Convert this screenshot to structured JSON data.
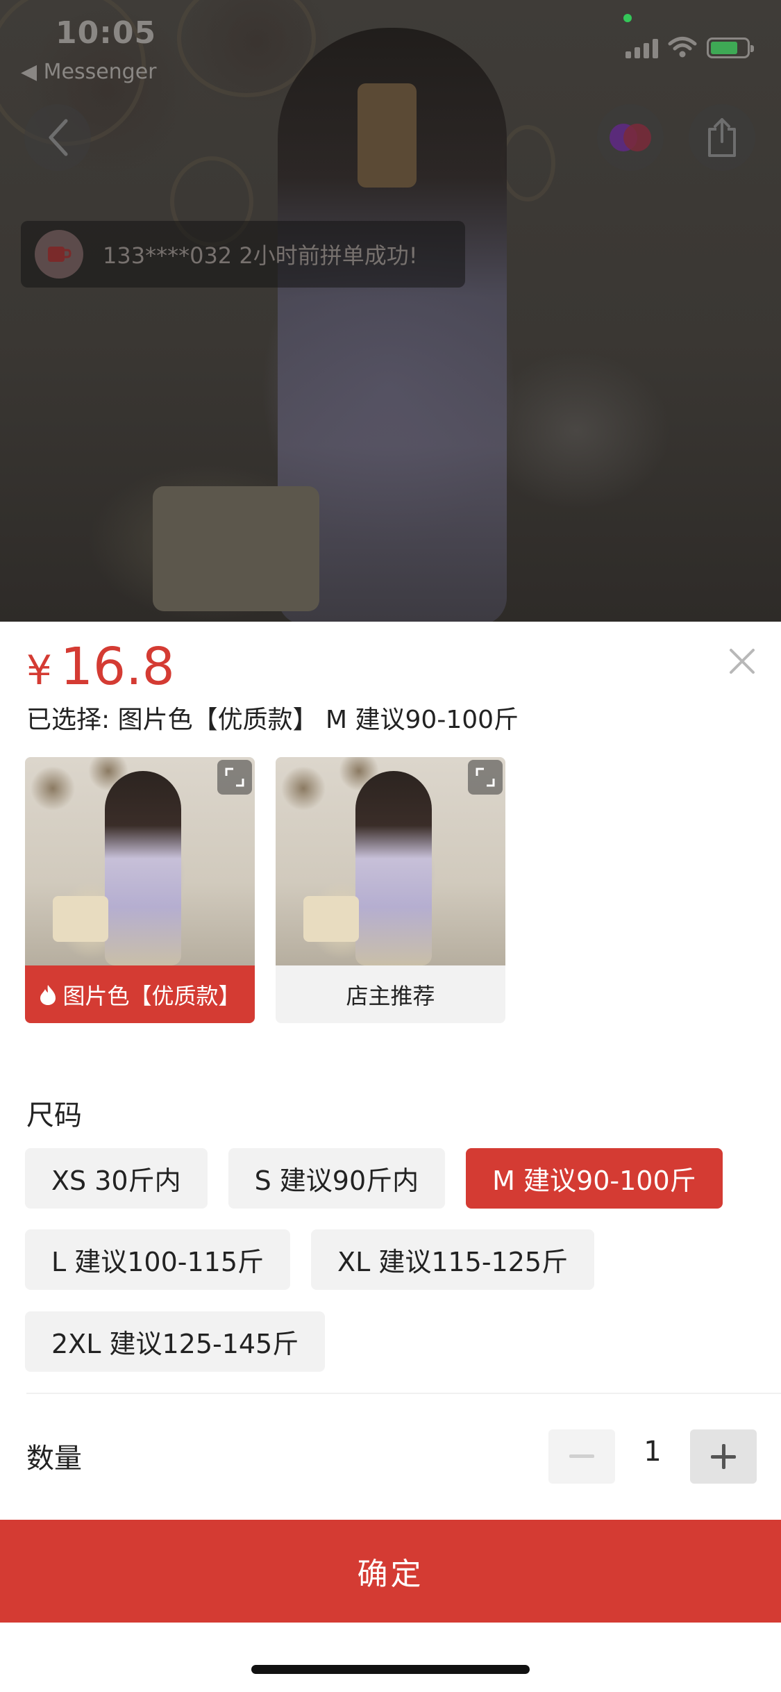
{
  "status_bar": {
    "time": "10:05",
    "back_app": "◀ Messenger",
    "icons": [
      "signal-icon",
      "wifi-icon",
      "battery-icon"
    ]
  },
  "photo_overlay": {
    "icons": [
      "back-icon",
      "favorite-icon",
      "share-icon"
    ],
    "notice": {
      "text": "133****032 2小时前拼单成功!",
      "icon": "cup-icon"
    }
  },
  "sheet": {
    "price_currency": "¥",
    "price_value": "16.8",
    "selected_text": "已选择: 图片色【优质款】 M 建议90-100斤",
    "colors": [
      {
        "label": "图片色【优质款】",
        "active": true,
        "icon": "flame-icon"
      },
      {
        "label": "店主推荐",
        "active": false
      }
    ],
    "size_title": "尺码",
    "sizes": [
      {
        "label": "XS 30斤内",
        "active": false
      },
      {
        "label": "S 建议90斤内",
        "active": false
      },
      {
        "label": "M 建议90-100斤",
        "active": true
      },
      {
        "label": "L 建议100-115斤",
        "active": false
      },
      {
        "label": "XL 建议115-125斤",
        "active": false
      },
      {
        "label": "2XL 建议125-145斤",
        "active": false
      }
    ],
    "quantity_label": "数量",
    "quantity_value": "1",
    "confirm_label": "确定"
  },
  "colors": {
    "accent": "#d43b33",
    "chip_bg": "#f2f2f2",
    "text": "#222222"
  }
}
